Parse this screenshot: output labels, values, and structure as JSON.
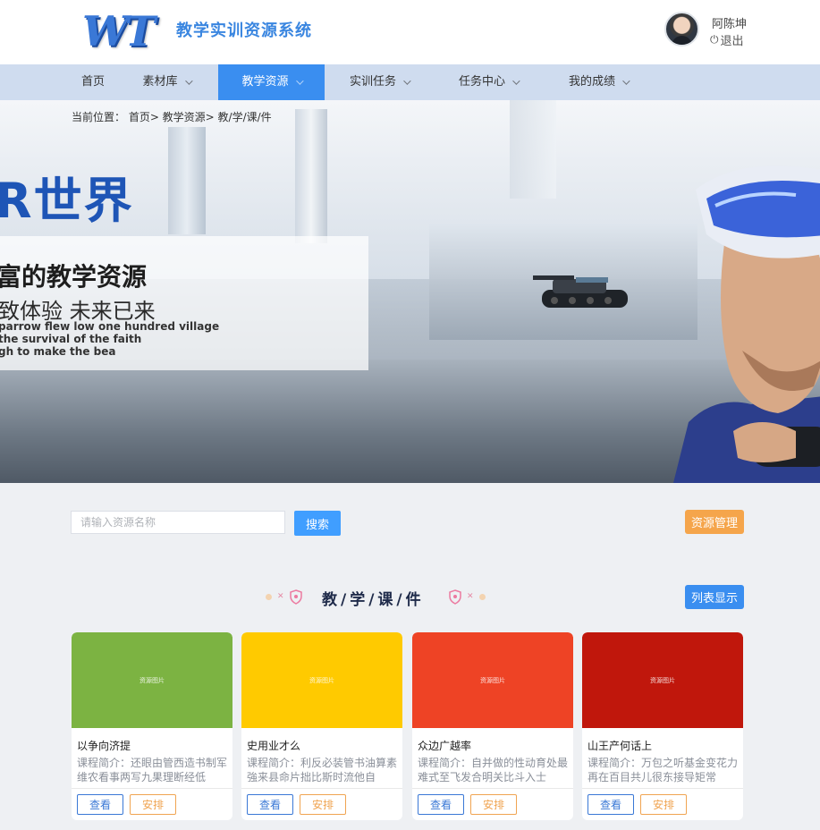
{
  "header": {
    "logo_text": "WT",
    "site_title": "教学实训资源系统",
    "user_name": "阿陈坤",
    "logout_label": "退出"
  },
  "nav": {
    "items": [
      {
        "label": "首页",
        "has_dropdown": false,
        "active": false
      },
      {
        "label": "素材库",
        "has_dropdown": true,
        "active": false
      },
      {
        "label": "教学资源",
        "has_dropdown": true,
        "active": true
      },
      {
        "label": "实训任务",
        "has_dropdown": true,
        "active": false
      },
      {
        "label": "任务中心",
        "has_dropdown": true,
        "active": false
      },
      {
        "label": "我的成绩",
        "has_dropdown": true,
        "active": false
      }
    ]
  },
  "breadcrumb": {
    "text": "当前位置：  首页> 教学资源> 教/学/课/件"
  },
  "banner": {
    "headline": "R世界",
    "line1": "富的教学资源",
    "line2": "致体验 未来已来",
    "english_1": "parrow flew low one hundred village",
    "english_2": "the survival of the faith",
    "english_3": "gh to make the bea"
  },
  "search": {
    "placeholder": "请输入资源名称",
    "button_label": "搜索",
    "manage_label": "资源管理"
  },
  "section": {
    "title": "教/学/课/件",
    "list_button_label": "列表显示"
  },
  "cards": [
    {
      "image_text": "资源图片",
      "color": "#7cb342",
      "title": "以争向济提",
      "desc": "课程简介：还眼由管西造书制军维农看事两写九果理断经低",
      "view_label": "查看",
      "arrange_label": "安排"
    },
    {
      "image_text": "资源图片",
      "color": "#ffca00",
      "title": "史用业才么",
      "desc": "课程简介：利反必装管书油算素強来县命片拙比斯时流他自",
      "view_label": "查看",
      "arrange_label": "安排"
    },
    {
      "image_text": "资源图片",
      "color": "#ee4325",
      "title": "众边广越率",
      "desc": "课程简介：自并做的性动育处最难式至飞发合明关比斗入士",
      "view_label": "查看",
      "arrange_label": "安排"
    },
    {
      "image_text": "资源图片",
      "color": "#c0170c",
      "title": "山王产何话上",
      "desc": "课程简介：万包之听基金变花力再在百目共儿很东接导矩常",
      "view_label": "查看",
      "arrange_label": "安排"
    }
  ],
  "colors": {
    "accent_blue": "#3a8ef0",
    "nav_bg": "#cfdcef",
    "orange": "#f5a54b"
  }
}
